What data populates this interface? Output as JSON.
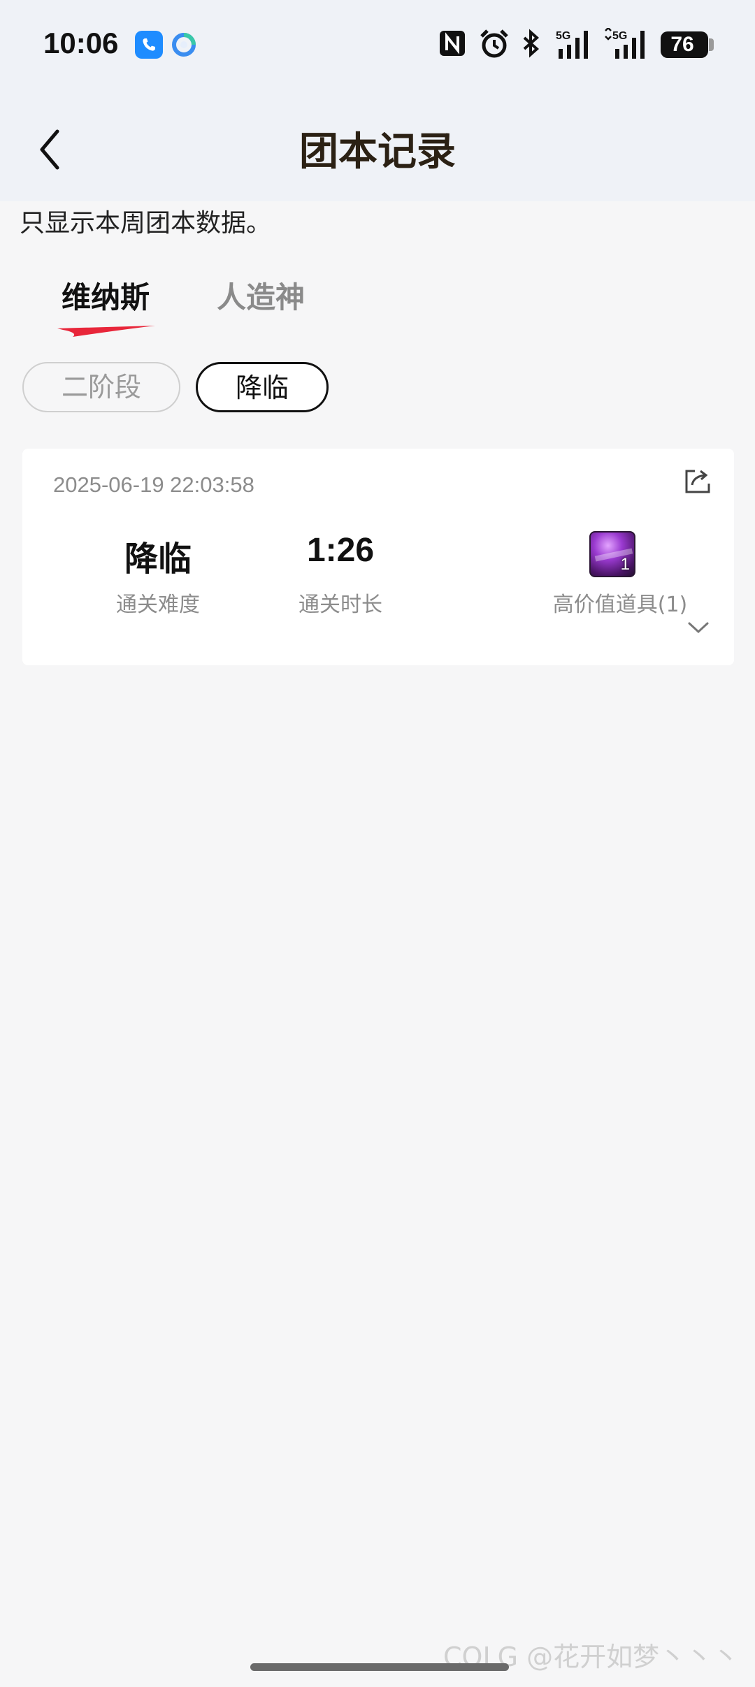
{
  "status_bar": {
    "time": "10:06",
    "battery": "76",
    "icons": [
      "phone-app-icon",
      "browser-app-icon",
      "nfc-icon",
      "alarm-icon",
      "bluetooth-icon",
      "signal-5g-icon",
      "signal-5g-icon"
    ]
  },
  "header": {
    "title": "团本记录",
    "back_icon": "chevron-left-icon"
  },
  "notice": "只显示本周团本数据。",
  "tabs": [
    {
      "label": "维纳斯",
      "active": true
    },
    {
      "label": "人造神",
      "active": false
    }
  ],
  "filters": [
    {
      "label": "二阶段",
      "selected": false
    },
    {
      "label": "降临",
      "selected": true
    }
  ],
  "record": {
    "timestamp": "2025-06-19 22:03:58",
    "difficulty_value": "降临",
    "difficulty_label": "通关难度",
    "duration_value": "1:26",
    "duration_label": "通关时长",
    "item_count": "1",
    "item_label": "高价值道具(1)"
  },
  "watermark": "COLG @花开如梦丶丶丶",
  "colors": {
    "accent_red": "#e8263a",
    "top_band": "#eff2f7",
    "page_bg": "#f6f6f7"
  }
}
